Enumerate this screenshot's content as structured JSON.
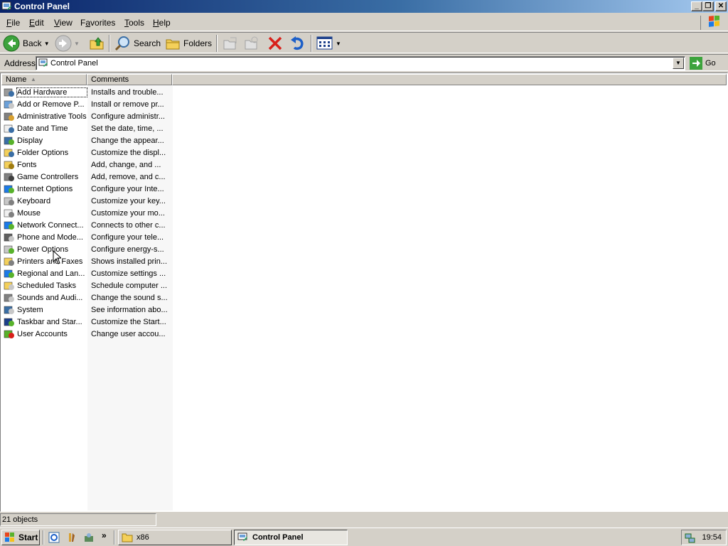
{
  "window": {
    "title": "Control Panel"
  },
  "menu": [
    {
      "key": "F",
      "rest": "ile"
    },
    {
      "key": "E",
      "rest": "dit"
    },
    {
      "key": "V",
      "rest": "iew"
    },
    {
      "key": "",
      "pre": "F",
      "key2": "a",
      "rest": "vorites"
    },
    {
      "key": "T",
      "rest": "ools"
    },
    {
      "key": "H",
      "rest": "elp"
    }
  ],
  "toolbar": {
    "back_label": "Back",
    "search_label": "Search",
    "folders_label": "Folders"
  },
  "address": {
    "label": "Address",
    "value": "Control Panel",
    "go_label": "Go"
  },
  "columns": {
    "name": "Name",
    "comments": "Comments"
  },
  "items": [
    {
      "name": "Add Hardware",
      "comment": "Installs and trouble...",
      "icon": "hardware-icon"
    },
    {
      "name": "Add or Remove P...",
      "comment": "Install or remove pr...",
      "icon": "add-remove-programs-icon"
    },
    {
      "name": "Administrative Tools",
      "comment": "Configure administr...",
      "icon": "admin-tools-icon"
    },
    {
      "name": "Date and Time",
      "comment": "Set the date, time, ...",
      "icon": "date-time-icon"
    },
    {
      "name": "Display",
      "comment": "Change the appear...",
      "icon": "display-icon"
    },
    {
      "name": "Folder Options",
      "comment": "Customize the displ...",
      "icon": "folder-options-icon"
    },
    {
      "name": "Fonts",
      "comment": "Add, change, and ...",
      "icon": "fonts-folder-icon"
    },
    {
      "name": "Game Controllers",
      "comment": "Add, remove, and c...",
      "icon": "game-controllers-icon"
    },
    {
      "name": "Internet Options",
      "comment": "Configure your Inte...",
      "icon": "internet-options-icon"
    },
    {
      "name": "Keyboard",
      "comment": "Customize your key...",
      "icon": "keyboard-icon"
    },
    {
      "name": "Mouse",
      "comment": "Customize your mo...",
      "icon": "mouse-icon"
    },
    {
      "name": "Network Connect...",
      "comment": "Connects to other c...",
      "icon": "network-connections-icon"
    },
    {
      "name": "Phone and Mode...",
      "comment": "Configure your tele...",
      "icon": "phone-modem-icon"
    },
    {
      "name": "Power Options",
      "comment": "Configure energy-s...",
      "icon": "power-options-icon"
    },
    {
      "name": "Printers and Faxes",
      "comment": "Shows installed prin...",
      "icon": "printers-faxes-icon"
    },
    {
      "name": "Regional and Lan...",
      "comment": "Customize settings ...",
      "icon": "regional-language-icon"
    },
    {
      "name": "Scheduled Tasks",
      "comment": "Schedule computer ...",
      "icon": "scheduled-tasks-icon"
    },
    {
      "name": "Sounds and Audi...",
      "comment": "Change the sound s...",
      "icon": "sounds-audio-icon"
    },
    {
      "name": "System",
      "comment": "See information abo...",
      "icon": "system-icon"
    },
    {
      "name": "Taskbar and Star...",
      "comment": "Customize the Start...",
      "icon": "taskbar-start-icon"
    },
    {
      "name": "User Accounts",
      "comment": "Change user accou...",
      "icon": "user-accounts-icon"
    }
  ],
  "status": {
    "count": "21 objects"
  },
  "taskbar": {
    "start_label": "Start",
    "tasks": [
      "x86",
      "Control Panel"
    ],
    "clock": "19:54"
  },
  "colors": {
    "title_start": "#0a246a",
    "title_end": "#a6caf0",
    "face": "#d4d0c8"
  }
}
